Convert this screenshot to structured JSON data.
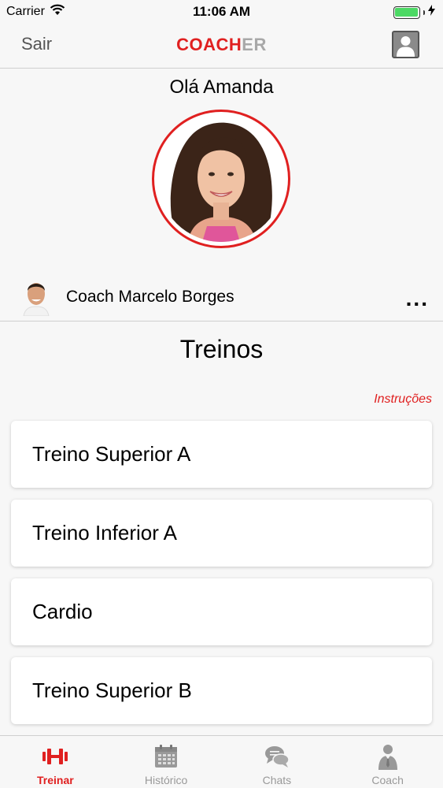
{
  "status_bar": {
    "carrier": "Carrier",
    "time": "11:06 AM"
  },
  "nav": {
    "left_label": "Sair",
    "logo": {
      "part1": "COACH",
      "part2": "ER"
    }
  },
  "header": {
    "greeting": "Olá Amanda",
    "coach_name": "Coach Marcelo Borges",
    "more_label": "..."
  },
  "workouts": {
    "title": "Treinos",
    "instructions_label": "Instruções",
    "items": [
      {
        "label": "Treino Superior A"
      },
      {
        "label": "Treino Inferior A"
      },
      {
        "label": "Cardio"
      },
      {
        "label": "Treino Superior B"
      }
    ]
  },
  "tabs": [
    {
      "label": "Treinar",
      "icon": "dumbbell-icon",
      "active": true
    },
    {
      "label": "Histórico",
      "icon": "calendar-icon",
      "active": false
    },
    {
      "label": "Chats",
      "icon": "chat-bubbles-icon",
      "active": false
    },
    {
      "label": "Coach",
      "icon": "coach-person-icon",
      "active": false
    }
  ],
  "colors": {
    "accent": "#e02020",
    "inactive": "#999999",
    "battery": "#4cd964"
  }
}
